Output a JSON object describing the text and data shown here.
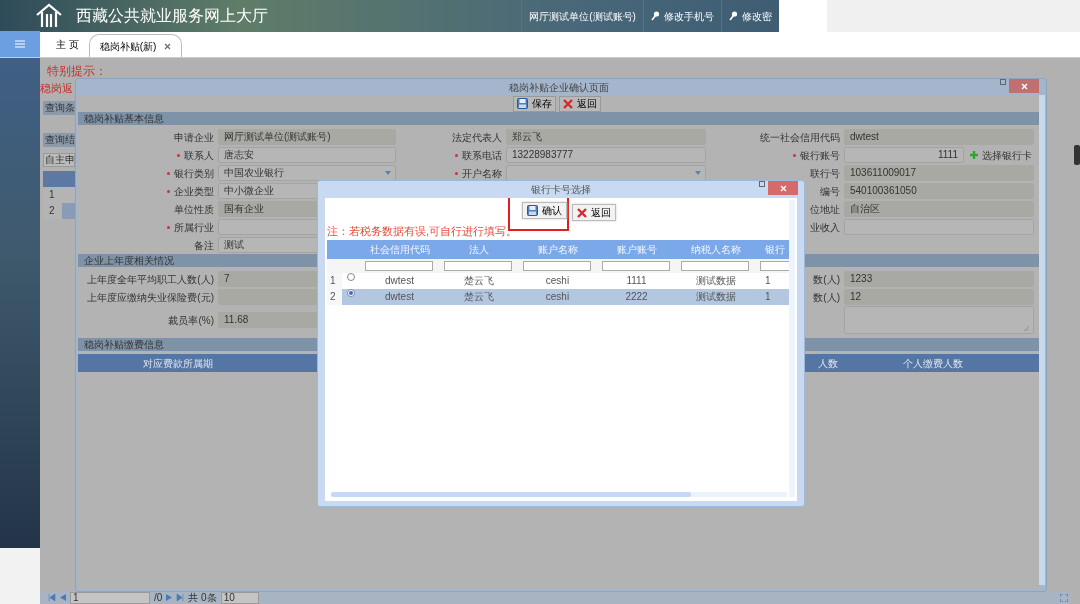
{
  "header": {
    "title": "西藏公共就业服务网上大厅",
    "user": "网厅测试单位(测试账号)",
    "links": [
      "修改手机号",
      "修改密"
    ]
  },
  "tabs": [
    {
      "label": "主 页",
      "selected": false,
      "closable": false
    },
    {
      "label": "稳岗补贴(新)",
      "selected": true,
      "closable": true
    }
  ],
  "background_page": {
    "notice_title": "特别提示：",
    "notice_text": "稳岗返",
    "panels": [
      "查询条",
      "查询结"
    ],
    "button": "自主申",
    "rows": [
      {
        "number": "1",
        "selected": false
      },
      {
        "number": "2",
        "selected": true
      }
    ]
  },
  "pager": {
    "page": "1",
    "pages": "/0",
    "total": "共 0条",
    "page_size": "10"
  },
  "confirm_dialog": {
    "title": "稳岗补贴企业确认页面",
    "buttons": [
      {
        "label": "保存",
        "kind": "save"
      },
      {
        "label": "返回",
        "kind": "close"
      }
    ],
    "sections": [
      {
        "title": "稳岗补贴基本信息",
        "rows": [
          [
            {
              "label": "申请企业",
              "required": false,
              "value": "网厅测试单位(测试账号)",
              "readonly": true,
              "kind": "text"
            },
            {
              "label": "法定代表人",
              "required": false,
              "value": "郑云飞",
              "readonly": true,
              "kind": "text"
            },
            {
              "label": "统一社会信用代码",
              "required": false,
              "value": "dwtest",
              "readonly": true,
              "kind": "text"
            }
          ],
          [
            {
              "label": "联系人",
              "required": true,
              "value": "唐志安",
              "readonly": false,
              "kind": "text"
            },
            {
              "label": "联系电话",
              "required": true,
              "value": "13228983777",
              "readonly": false,
              "kind": "text"
            },
            {
              "label": "银行账号",
              "required": true,
              "value": "1111",
              "readonly": false,
              "kind": "account",
              "action": "选择银行卡"
            }
          ],
          [
            {
              "label": "银行类别",
              "required": true,
              "value": "中国农业银行",
              "readonly": false,
              "kind": "select"
            },
            {
              "label": "开户名称",
              "required": true,
              "readonly": false,
              "kind": "select"
            },
            {
              "label": "联行号",
              "required": false,
              "value": "103611009017",
              "readonly": true,
              "kind": "text"
            }
          ],
          [
            {
              "label": "企业类型",
              "required": true,
              "value": "中小微企业",
              "readonly": false,
              "kind": "text"
            },
            null,
            {
              "label": "编号",
              "required": false,
              "value": "540100361050",
              "readonly": true,
              "kind": "text"
            }
          ],
          [
            {
              "label": "单位性质",
              "required": false,
              "value": "国有企业",
              "readonly": true,
              "kind": "text"
            },
            null,
            {
              "label": "位地址",
              "required": false,
              "value": "自治区",
              "readonly": true,
              "kind": "text"
            }
          ],
          [
            {
              "label": "所属行业",
              "required": true,
              "readonly": false,
              "kind": "text"
            },
            null,
            {
              "label": "业收入",
              "required": false,
              "readonly": false,
              "kind": "text"
            }
          ],
          [
            {
              "label": "备注",
              "required": false,
              "value": "测试",
              "readonly": false,
              "kind": "text"
            },
            null,
            null
          ]
        ]
      },
      {
        "title": "企业上年度相关情况",
        "rows": [
          [
            {
              "label": "上年度全年平均职工人数(人)",
              "required": false,
              "value": "7",
              "readonly": true,
              "kind": "text"
            },
            null,
            {
              "label": "数(人)",
              "required": false,
              "value": "1233",
              "readonly": true,
              "kind": "text"
            }
          ],
          [
            {
              "label": "上年度应缴纳失业保险费(元)",
              "required": false,
              "readonly": true,
              "kind": "text"
            },
            null,
            {
              "label": "数(人)",
              "required": false,
              "value": "12",
              "readonly": true,
              "kind": "text"
            }
          ],
          [
            {
              "label": "裁员率(%)",
              "required": false,
              "value": "11.68",
              "readonly": true,
              "kind": "text"
            },
            null,
            {
              "readonly": false,
              "kind": "textarea"
            }
          ]
        ]
      },
      {
        "title": "稳岗补贴缴费信息",
        "columns": [
          "对应费款所属期",
          "人数",
          "个人缴费人数"
        ]
      }
    ]
  },
  "card_dialog": {
    "title": "银行卡号选择",
    "buttons": [
      {
        "label": "确认",
        "kind": "save",
        "highlighted": true
      },
      {
        "label": "返回",
        "kind": "close",
        "highlighted": false
      }
    ],
    "note": "注：若税务数据有误,可自行进行填写。",
    "columns": [
      "社会信用代码",
      "法人",
      "账户名称",
      "账户账号",
      "纳税人名称",
      "银行"
    ],
    "rows": [
      {
        "number": "1",
        "selected": false,
        "cells": [
          "dwtest",
          "楚云飞",
          "ceshi",
          "1111",
          "测试数据",
          "1"
        ]
      },
      {
        "number": "2",
        "selected": true,
        "cells": [
          "dwtest",
          "楚云飞",
          "ceshi",
          "2222",
          "测试数据",
          "1"
        ]
      }
    ]
  }
}
